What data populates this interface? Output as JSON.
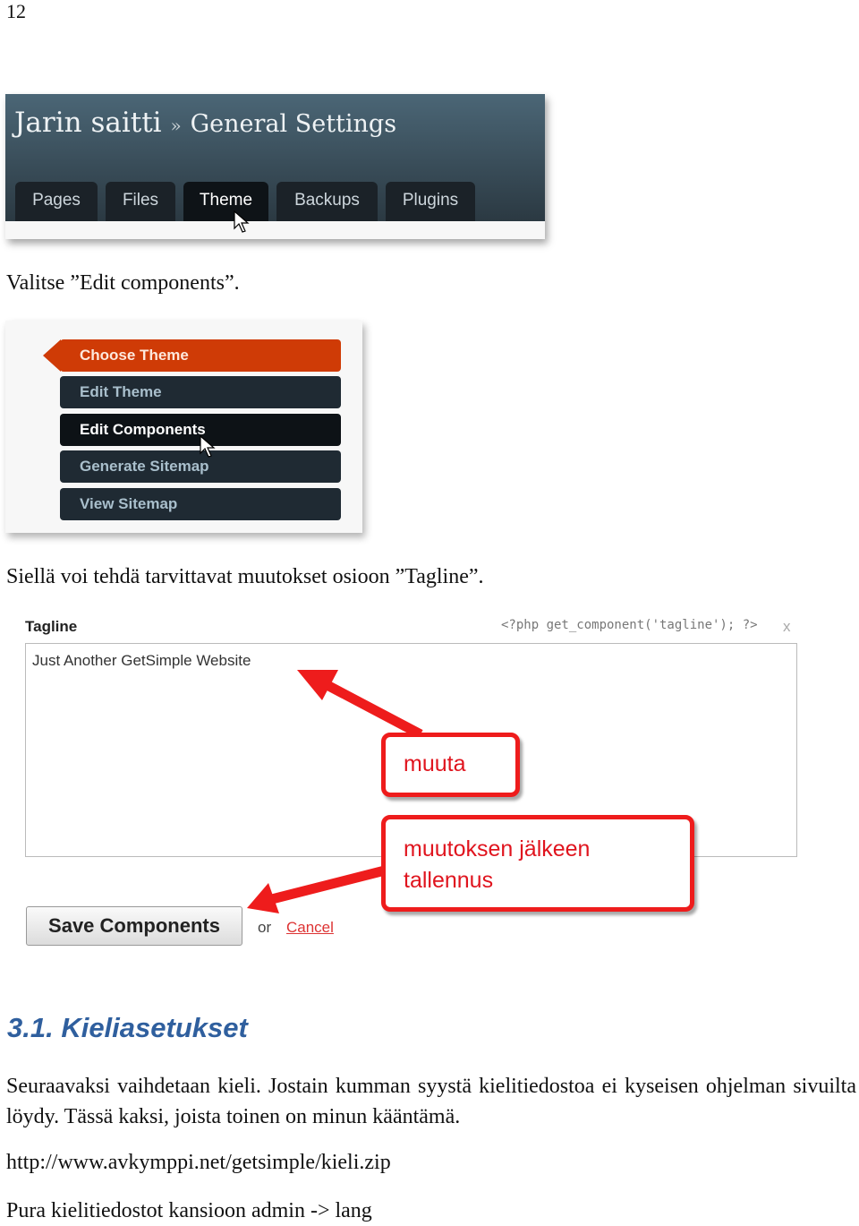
{
  "page_number": "12",
  "screenshot1": {
    "site": "Jarin saitti",
    "separator": "»",
    "section": "General Settings",
    "tabs": [
      "Pages",
      "Files",
      "Theme",
      "Backups",
      "Plugins"
    ],
    "active_tab": "Theme"
  },
  "text1": "Valitse ”Edit components”.",
  "screenshot2": {
    "items": [
      "Choose Theme",
      "Edit Theme",
      "Edit Components",
      "Generate Sitemap",
      "View Sitemap"
    ],
    "current": "Choose Theme",
    "hovered": "Edit Components",
    "accent": "#cf3b06"
  },
  "text2": "Siellä voi tehdä tarvittavat muutokset osioon ”Tagline”.",
  "screenshot3": {
    "label": "Tagline",
    "code": "<?php get_component('tagline'); ?>",
    "close": "x",
    "value": "Just Another GetSimple Website",
    "callout1": "muuta",
    "callout2_line1": "muutoksen jälkeen",
    "callout2_line2": "tallennus",
    "save": "Save Components",
    "or": "or",
    "cancel": "Cancel",
    "arrow_color": "#ee1c1c"
  },
  "heading": "3.1. Kieliasetukset",
  "paragraph": "Seuraavaksi vaihdetaan kieli. Jostain kumman syystä kielitiedostoa ei kyseisen ohjelman sivuilta löydy. Tässä kaksi, joista toinen on minun kääntämä.",
  "url": "http://www.avkymppi.net/getsimple/kieli.zip",
  "last_line": "Pura kielitiedostot kansioon admin -> lang"
}
